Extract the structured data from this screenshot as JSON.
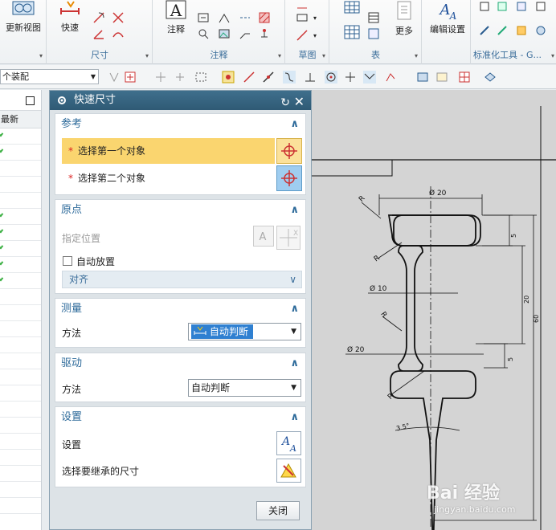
{
  "ribbon": {
    "groups": [
      {
        "label": "",
        "buttons": [
          {
            "label": "更新视图"
          }
        ]
      },
      {
        "label": "尺寸",
        "buttons": [
          {
            "label": "快速"
          }
        ]
      },
      {
        "label": "注释",
        "buttons": [
          {
            "label": "注释"
          }
        ]
      },
      {
        "label": "草图",
        "buttons": []
      },
      {
        "label": "表",
        "buttons": [
          {
            "label": "更多"
          }
        ]
      },
      {
        "label": "",
        "buttons": [
          {
            "label": "编辑设置"
          }
        ]
      },
      {
        "label": "标准化工具 - G...",
        "buttons": []
      }
    ]
  },
  "toolbar2": {
    "assembly_select": "个装配"
  },
  "leftnav": {
    "column_header": "最新",
    "rows": 11
  },
  "dialog": {
    "title": "快速尺寸",
    "sections": {
      "reference": {
        "title": "参考",
        "first_object": "选择第一个对象",
        "second_object": "选择第二个对象"
      },
      "origin": {
        "title": "原点",
        "specify_location": "指定位置",
        "auto_place": "自动放置",
        "align": "对齐"
      },
      "measurement": {
        "title": "测量",
        "method_label": "方法",
        "method_value": "自动判断"
      },
      "drive": {
        "title": "驱动",
        "method_label": "方法",
        "method_value": "自动判断"
      },
      "settings": {
        "title": "设置",
        "settings_label": "设置",
        "inherit_label": "选择要继承的尺寸"
      }
    },
    "close_button": "关闭"
  },
  "drawing": {
    "dims": {
      "top_dia": "Ø 20",
      "mid_dia": "Ø 10",
      "low_dia": "Ø 20",
      "r_top": "R",
      "r_mid1": "R",
      "r_mid2": "R",
      "r_low": "R",
      "h5_top": "5",
      "h20": "20",
      "h60": "60",
      "h5_low": "5",
      "angle": "3.5°"
    }
  },
  "watermark": {
    "brand": "Bai 经验",
    "url": "jingyan.baidu.com"
  }
}
